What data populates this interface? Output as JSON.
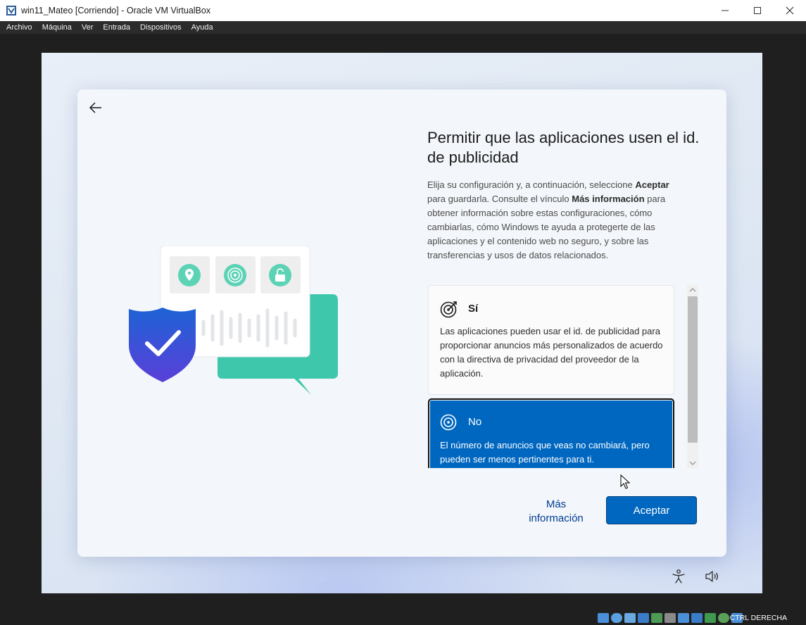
{
  "window": {
    "title": "win11_Mateo [Corriendo] - Oracle VM VirtualBox"
  },
  "menu": [
    "Archivo",
    "Máquina",
    "Ver",
    "Entrada",
    "Dispositivos",
    "Ayuda"
  ],
  "oobe": {
    "heading": "Permitir que las aplicaciones usen el id. de publicidad",
    "description_parts": {
      "p1": "Elija su configuración y, a continuación, seleccione ",
      "b1": "Aceptar",
      "p2": " para guardarla. Consulte el vínculo ",
      "b2": "Más información",
      "p3": " para obtener información sobre estas configuraciones, cómo cambiarlas, cómo Windows te ayuda a protegerte de las aplicaciones y el contenido web no seguro, y sobre las transferencias y usos de datos relacionados."
    },
    "options": [
      {
        "title": "Sí",
        "body": "Las aplicaciones pueden usar el id. de publicidad para proporcionar anuncios más personalizados de acuerdo con la directiva de privacidad del proveedor de la aplicación.",
        "selected": false
      },
      {
        "title": "No",
        "body": "El número de anuncios que veas no cambiará, pero pueden ser menos pertinentes para ti.",
        "selected": true
      }
    ],
    "more_info_line1": "Más",
    "more_info_line2": "información",
    "accept_label": "Aceptar"
  },
  "status": {
    "host_key": "CTRL DERECHA",
    "icon_names": [
      "hdd-icon",
      "optical-drive-icon",
      "audio-icon",
      "network-icon",
      "usb-icon",
      "shared-folder-icon",
      "display-icon",
      "video-capture-icon",
      "cpu-icon",
      "mouse-integration-icon",
      "keyboard-icon"
    ]
  },
  "colors": {
    "accent": "#0067c0",
    "title_text": "#1b1b1b"
  }
}
